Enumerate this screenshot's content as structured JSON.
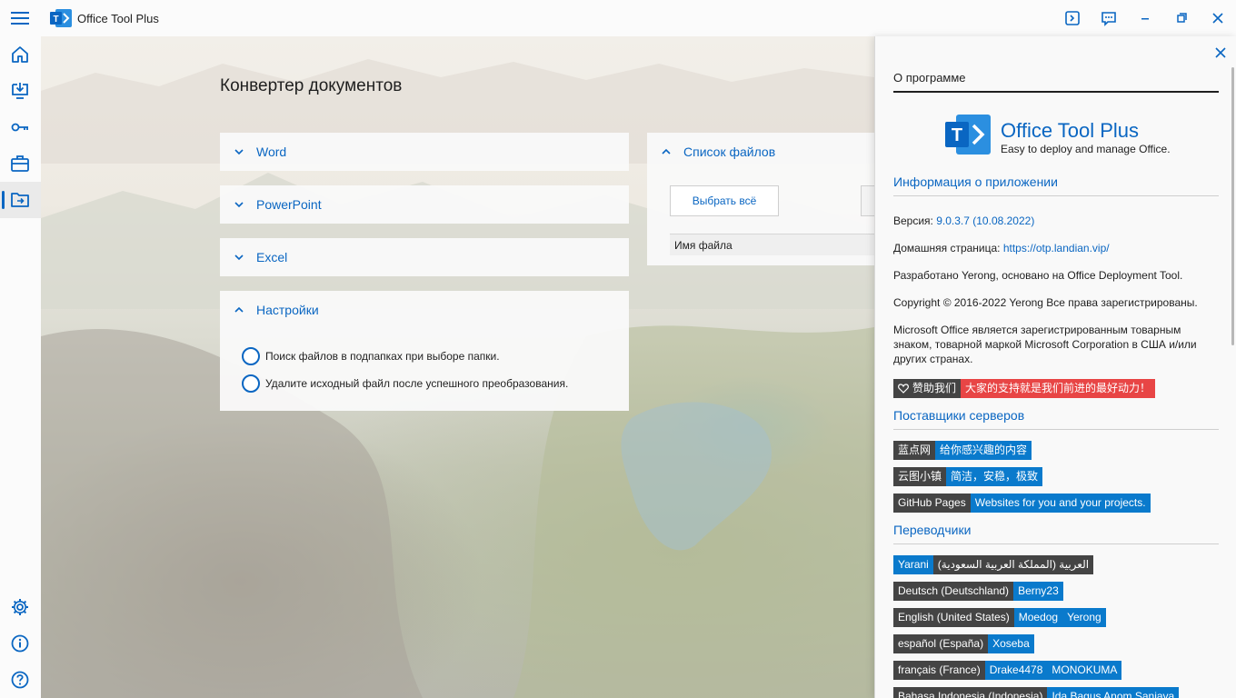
{
  "window": {
    "title": "Office Tool Plus"
  },
  "main": {
    "page_title": "Конвертер документов",
    "expanders": [
      "Word",
      "PowerPoint",
      "Excel",
      "Настройки"
    ],
    "settings_options": [
      "Поиск файлов в подпапках при выборе папки.",
      "Удалите исходный файл после успешного преобразования."
    ],
    "file_list": {
      "title": "Список файлов",
      "select_all": "Выбрать всё",
      "column_name": "Имя файла"
    }
  },
  "about": {
    "tab": "О программе",
    "brand_name": "Office Tool Plus",
    "brand_tagline": "Easy to deploy and manage Office.",
    "app_info_title": "Информация о приложении",
    "version_label": "Версия:",
    "version_value": "9.0.3.7 (10.08.2022)",
    "homepage_label": "Домашняя страница:",
    "homepage_value": "https://otp.landian.vip/",
    "developed_by": "Разработано Yerong, основано на Office Deployment Tool.",
    "copyright": "Copyright © 2016-2022 Yerong Все права зарегистрированы.",
    "trademark": "Microsoft Office является зарегистрированным товарным знаком, товарной маркой Microsoft Corporation в США и/или других странах.",
    "sponsor_label": "赞助我们",
    "sponsor_text": "大家的支持就是我们前进的最好动力！",
    "providers_title": "Поставщики серверов",
    "providers": [
      {
        "name": "蓝点网",
        "desc": "给你感兴趣的内容"
      },
      {
        "name": "云图小镇",
        "desc": "简洁，安稳，极致"
      },
      {
        "name": "GitHub Pages",
        "desc": "Websites for you and your projects."
      }
    ],
    "translators_title": "Переводчики",
    "translators": [
      {
        "left": "Yarani",
        "right": "العربية (المملكة العربية السعودية)"
      },
      {
        "lang": "Deutsch (Deutschland)",
        "people": [
          "Berny23"
        ]
      },
      {
        "lang": "English (United States)",
        "people": [
          "Moedog",
          "Yerong"
        ]
      },
      {
        "lang": "español (España)",
        "people": [
          "Xoseba"
        ]
      },
      {
        "lang": "français (France)",
        "people": [
          "Drake4478",
          "MONOKUMA"
        ]
      },
      {
        "lang": "Bahasa Indonesia (Indonesia)",
        "people": [
          "Ida Bagus Anom Sanjaya"
        ]
      }
    ]
  },
  "colors": {
    "accent": "#0a66c2",
    "badge_dark": "#444444",
    "badge_blue": "#0a7acc",
    "badge_red": "#e84545"
  }
}
